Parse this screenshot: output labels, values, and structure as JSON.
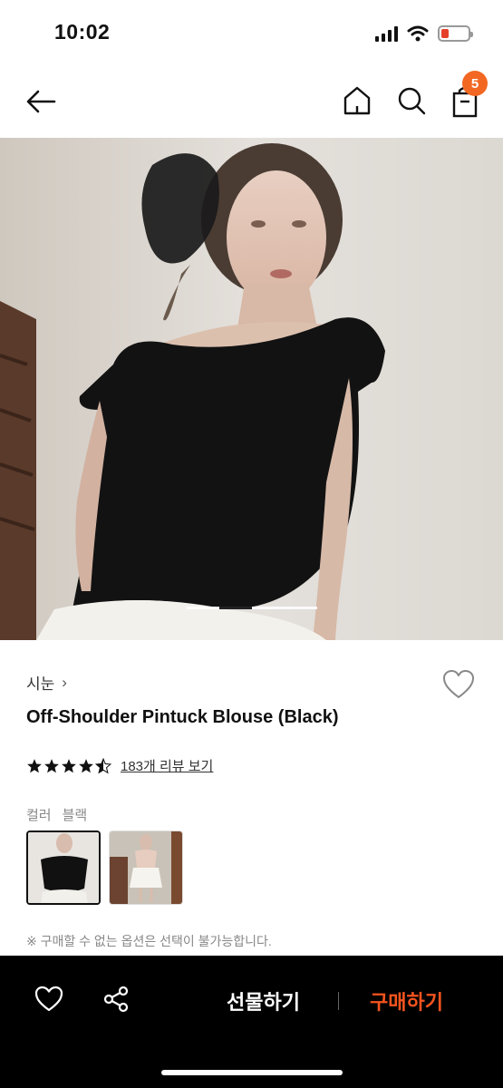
{
  "status_bar": {
    "time": "10:02",
    "icons": [
      "signal-icon",
      "wifi-icon",
      "battery-icon"
    ]
  },
  "nav": {
    "back_icon": "back-arrow-icon",
    "home_icon": "home-icon",
    "search_icon": "search-icon",
    "cart_icon": "shopping-bag-icon",
    "cart_count": "5"
  },
  "product": {
    "brand": "시눈",
    "brand_chevron": "›",
    "title": "Off-Shoulder Pintuck Blouse (Black)",
    "rating": 4.5,
    "review_link": "183개 리뷰 보기",
    "color_label": "컬러",
    "color_value": "블랙",
    "notice": "※ 구매할 수 없는 옵션은 선택이 불가능합니다.",
    "image_indicator": {
      "total": 4,
      "active": 1
    }
  },
  "bottom_bar": {
    "wish_icon": "heart-icon",
    "share_icon": "share-icon",
    "gift_label": "선물하기",
    "buy_label": "구매하기"
  },
  "colors": {
    "accent": "#f26722",
    "buy": "#f5541e",
    "bottom_bar_bg": "#000000"
  }
}
